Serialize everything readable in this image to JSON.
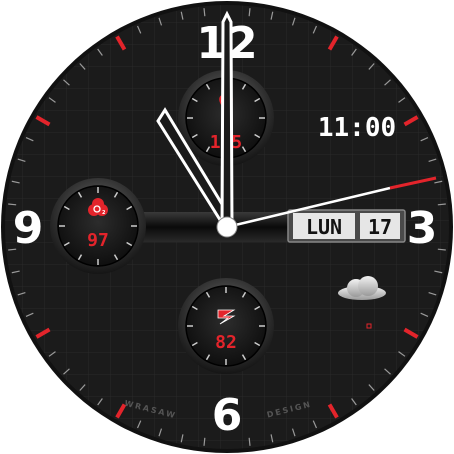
{
  "watch": {
    "numerals": {
      "top": "12",
      "right": "3",
      "bottom": "6",
      "left": "9"
    },
    "digital_time": "11:00",
    "date": {
      "day": "LUN",
      "number": "17"
    },
    "brand": {
      "left": "WRASAW",
      "right": "DESIGN"
    },
    "subdials": {
      "heart_rate": {
        "value": "115",
        "icon": "heart-icon"
      },
      "oxygen": {
        "value": "97",
        "icon": "oxygen-o2-icon"
      },
      "steps": {
        "value": "82",
        "icon": "lightning-icon"
      }
    },
    "weather_icon": "cloud-icon",
    "colors": {
      "accent": "#e3242b",
      "background": "#1a1a1a",
      "hands": "#ffffff"
    }
  }
}
